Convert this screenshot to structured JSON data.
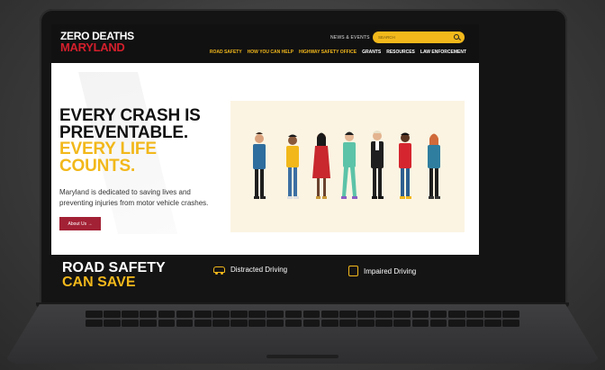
{
  "brand": {
    "line1": "ZERO DEATHS",
    "line2": "MARYLAND"
  },
  "header": {
    "news_link": "NEWS & EVENTS",
    "search_placeholder": "SEARCH",
    "nav": [
      {
        "label": "ROAD SAFETY",
        "style": "gold"
      },
      {
        "label": "HOW YOU CAN HELP",
        "style": "gold"
      },
      {
        "label": "HIGHWAY SAFETY OFFICE",
        "style": "gold"
      },
      {
        "label": "GRANTS",
        "style": "white"
      },
      {
        "label": "RESOURCES",
        "style": "white"
      },
      {
        "label": "LAW ENFORCEMENT",
        "style": "white"
      }
    ]
  },
  "hero": {
    "headline_line1": "EVERY CRASH IS",
    "headline_line2": "PREVENTABLE.",
    "headline_line3": "EVERY LIFE",
    "headline_line4": "COUNTS.",
    "body": "Maryland is dedicated to saving lives and preventing injuries from motor vehicle crashes.",
    "button_label": "About Us →"
  },
  "band": {
    "title_line1": "ROAD SAFETY",
    "title_line2": "CAN SAVE",
    "topics": [
      {
        "label": "Distracted Driving",
        "icon": "car-icon"
      },
      {
        "label": "Impaired Driving",
        "icon": "glass-icon"
      }
    ]
  },
  "colors": {
    "gold": "#f2b81b",
    "red": "#d41f2c",
    "maroon": "#a32135",
    "dark": "#111111",
    "illustration_bg": "#fbf4e2"
  }
}
